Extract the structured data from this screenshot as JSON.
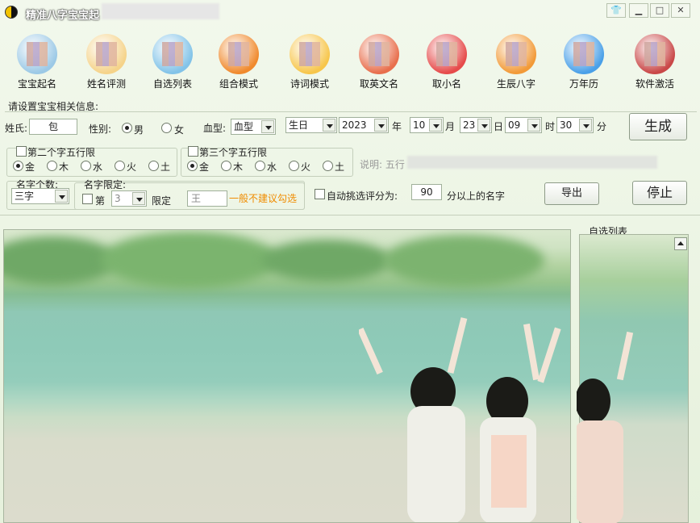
{
  "app": {
    "title": "精准八字宝宝起"
  },
  "toolbar": [
    {
      "label": "宝宝起名",
      "icon": "baby-name-icon",
      "color": "#9cc9e6"
    },
    {
      "label": "姓名评测",
      "icon": "name-test-icon",
      "color": "#f5d38a"
    },
    {
      "label": "自选列表",
      "icon": "custom-list-icon",
      "color": "#82c3e8"
    },
    {
      "label": "组合模式",
      "icon": "combo-mode-icon",
      "color": "#f08a2e"
    },
    {
      "label": "诗词模式",
      "icon": "poem-mode-icon",
      "color": "#f7c64c"
    },
    {
      "label": "取英文名",
      "icon": "english-name-icon",
      "color": "#e86f4d"
    },
    {
      "label": "取小名",
      "icon": "nickname-icon",
      "color": "#e64b4b"
    },
    {
      "label": "生辰八字",
      "icon": "bazi-icon",
      "color": "#f29a38"
    },
    {
      "label": "万年历",
      "icon": "calendar-icon",
      "color": "#4aa0e8"
    },
    {
      "label": "软件激活",
      "icon": "activate-icon",
      "color": "#c94848"
    }
  ],
  "form": {
    "section_title": "请设置宝宝相关信息:",
    "surname_label": "姓氏:",
    "surname_value": "包",
    "gender_label": "性别:",
    "gender_male": "男",
    "gender_female": "女",
    "blood_label": "血型:",
    "blood_value": "血型",
    "birthday_value": "生日",
    "year_value": "2023",
    "year_unit": "年",
    "month_value": "10",
    "month_unit": "月",
    "day_value": "23",
    "day_unit": "日",
    "hour_value": "09",
    "hour_unit": "时",
    "minute_value": "30",
    "minute_unit": "分",
    "generate_label": "生成",
    "second_char_label": "第二个字五行限",
    "third_char_label": "第三个字五行限",
    "elements": [
      "金",
      "木",
      "水",
      "火",
      "土"
    ],
    "note_label": "说明: 五行",
    "name_count_label": "名字个数:",
    "name_count_value": "三字",
    "name_limit_label": "名字限定:",
    "limit_position_label": "第",
    "limit_position_value": "3",
    "limit_text": "限定",
    "limit_char_value": "王",
    "limit_hint": "一般不建议勾选",
    "auto_pick_label": "自动挑选评分为:",
    "auto_pick_score": "90",
    "auto_pick_suffix": "分以上的名字",
    "export_label": "导出",
    "stop_label": "停止"
  },
  "side_panel": {
    "title": "自选列表"
  },
  "colors": {
    "hint_orange": "#f08c00",
    "accent_green": "#e6f1dc"
  }
}
